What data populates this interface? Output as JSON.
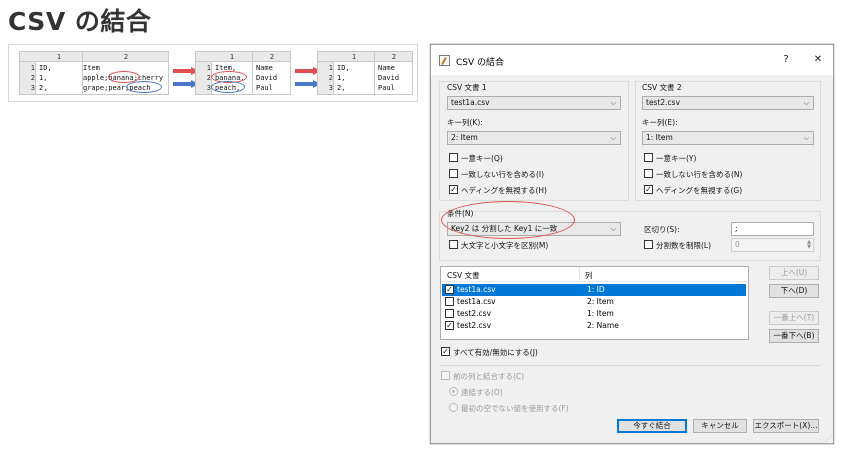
{
  "page": {
    "heading": "CSV の結合"
  },
  "illustration": {
    "table1": {
      "headers": [
        "1",
        "2"
      ],
      "rows": [
        {
          "num": "1",
          "c1": "ID,",
          "c2": "Item"
        },
        {
          "num": "2",
          "c1": "1,",
          "c2": "apple;banana;cherry"
        },
        {
          "num": "3",
          "c1": "2,",
          "c2": "grape;pear;peach"
        }
      ]
    },
    "table2": {
      "headers": [
        "1",
        "2"
      ],
      "rows": [
        {
          "num": "1",
          "c1": "Item,",
          "c2": "Name"
        },
        {
          "num": "2",
          "c1": "banana,",
          "c2": "David"
        },
        {
          "num": "3",
          "c1": "peach,",
          "c2": "Paul"
        }
      ]
    },
    "table3": {
      "headers": [
        "1",
        "2"
      ],
      "rows": [
        {
          "num": "1",
          "c1": "ID,",
          "c2": "Name"
        },
        {
          "num": "2",
          "c1": "1,",
          "c2": "David"
        },
        {
          "num": "3",
          "c1": "2,",
          "c2": "Paul"
        }
      ]
    },
    "colors": {
      "red_arrow": "#e05050",
      "blue_arrow": "#4a78c8"
    }
  },
  "dialog": {
    "title": "CSV の結合",
    "help_label": "?",
    "close_label": "✕",
    "doc1": {
      "group_label": "CSV 文書 1",
      "file_value": "test1a.csv",
      "key_label": "キー列(K):",
      "key_value": "2: Item",
      "check_multi_key": {
        "label": "一意キー(Q)",
        "checked": false
      },
      "check_include_unmatched": {
        "label": "一致しない行を含める(I)",
        "checked": false
      },
      "check_ignore_heading": {
        "label": "ヘディングを無視する(H)",
        "checked": true
      }
    },
    "doc2": {
      "group_label": "CSV 文書 2",
      "file_value": "test2.csv",
      "key_label": "キー列(E):",
      "key_value": "1: Item",
      "check_multi_key": {
        "label": "一意キー(Y)",
        "checked": false
      },
      "check_include_unmatched": {
        "label": "一致しない行を含める(N)",
        "checked": false
      },
      "check_ignore_heading": {
        "label": "ヘディングを無視する(G)",
        "checked": true
      }
    },
    "condition": {
      "label": "条件(N)",
      "value": "Key2 は 分割した Key1 に一致",
      "case_check": {
        "label": "大文字と小文字を区別(M)",
        "checked": false
      },
      "delimiter_label": "区切り(S):",
      "delimiter_value": ";",
      "limit_check": {
        "label": "分割数を制限(L)",
        "checked": false
      },
      "limit_value": "0"
    },
    "columns": {
      "headers": [
        "CSV 文書",
        "列"
      ],
      "rows": [
        {
          "doc": "test1a.csv",
          "col": "1: ID",
          "checked": true,
          "selected": true
        },
        {
          "doc": "test1a.csv",
          "col": "2: Item",
          "checked": false,
          "selected": false
        },
        {
          "doc": "test2.csv",
          "col": "1: Item",
          "checked": false,
          "selected": false
        },
        {
          "doc": "test2.csv",
          "col": "2: Name",
          "checked": true,
          "selected": false
        }
      ],
      "up_label": "上へ(U)",
      "down_label": "下へ(D)",
      "top_label": "一番上へ(T)",
      "bottom_label": "一番下へ(B)",
      "toggle_all": {
        "label": "すべて有効/無効にする(J)",
        "checked": true
      }
    },
    "merge_prev": {
      "check_label": "前の列と結合する(C)",
      "radio_concat": "連結する(O)",
      "radio_first_nonempty": "最初の空でない値を使用する(F)"
    },
    "buttons": {
      "merge_now": "今すぐ結合",
      "cancel": "キャンセル",
      "export": "エクスポート(X)..."
    }
  }
}
